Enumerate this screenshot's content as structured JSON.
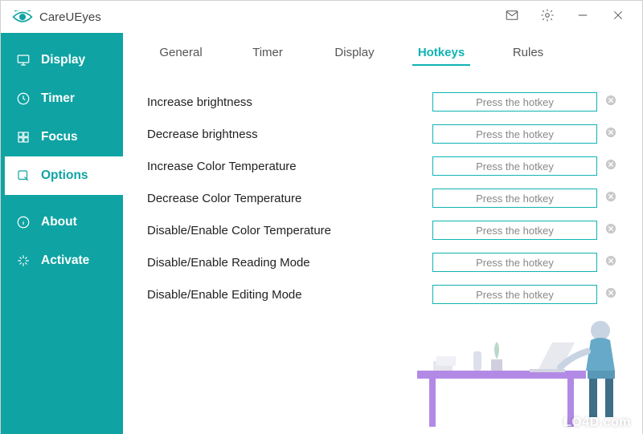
{
  "app": {
    "title": "CareUEyes"
  },
  "titlebar": {
    "feedback_icon": "mail-icon",
    "settings_icon": "gear-icon",
    "minimize_icon": "minimize-icon",
    "close_icon": "close-icon"
  },
  "sidebar": {
    "items": [
      {
        "id": "display",
        "label": "Display",
        "active": false
      },
      {
        "id": "timer",
        "label": "Timer",
        "active": false
      },
      {
        "id": "focus",
        "label": "Focus",
        "active": false
      },
      {
        "id": "options",
        "label": "Options",
        "active": true
      },
      {
        "id": "about",
        "label": "About",
        "active": false
      },
      {
        "id": "activate",
        "label": "Activate",
        "active": false
      }
    ]
  },
  "tabs": {
    "items": [
      {
        "id": "general",
        "label": "General",
        "active": false
      },
      {
        "id": "timer",
        "label": "Timer",
        "active": false
      },
      {
        "id": "display",
        "label": "Display",
        "active": false
      },
      {
        "id": "hotkeys",
        "label": "Hotkeys",
        "active": true
      },
      {
        "id": "rules",
        "label": "Rules",
        "active": false
      }
    ]
  },
  "hotkeys": {
    "placeholder": "Press the hotkey",
    "rows": [
      {
        "label": "Increase brightness",
        "value": ""
      },
      {
        "label": "Decrease brightness",
        "value": ""
      },
      {
        "label": "Increase Color Temperature",
        "value": ""
      },
      {
        "label": "Decrease Color Temperature",
        "value": ""
      },
      {
        "label": "Disable/Enable Color Temperature",
        "value": ""
      },
      {
        "label": "Disable/Enable Reading Mode",
        "value": ""
      },
      {
        "label": "Disable/Enable Editing Mode",
        "value": ""
      }
    ]
  },
  "watermark": "LO4D.com",
  "colors": {
    "accent": "#0fa3a3"
  }
}
